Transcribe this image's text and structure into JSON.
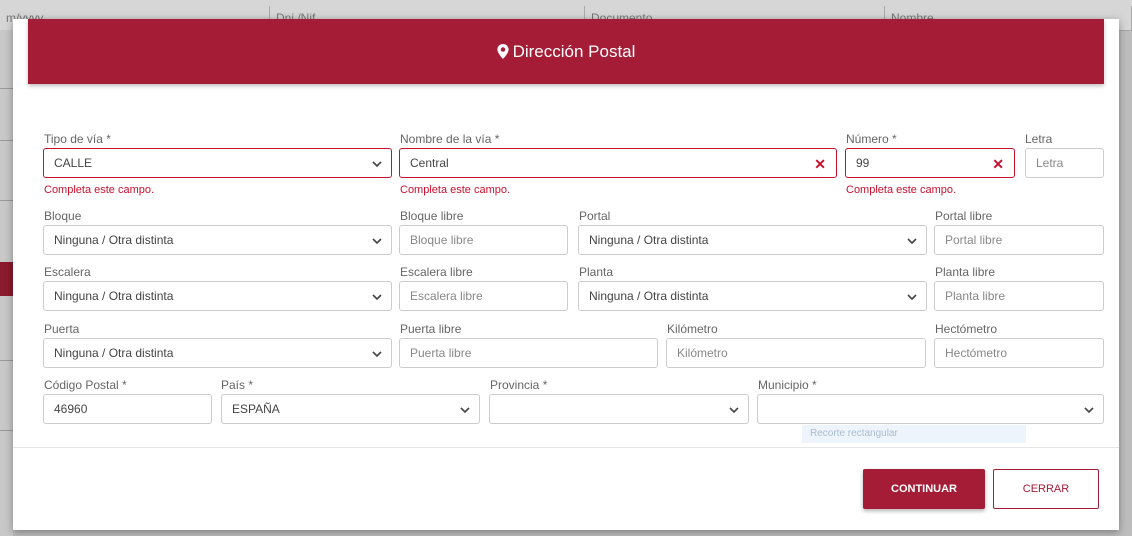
{
  "background": {
    "fields": [
      "m/yyyy",
      "Dni /Nif",
      "Documento",
      "Nombre"
    ]
  },
  "modal": {
    "title": "Dirección Postal",
    "title_icon": "map-marker-icon",
    "accent_color": "#a51c36",
    "error_color": "#c8102e",
    "rows": {
      "row1": {
        "tipo_via": {
          "label": "Tipo de vía *",
          "value": "CALLE",
          "error": "Completa este campo."
        },
        "nombre_via": {
          "label": "Nombre de la vía *",
          "value": "Central",
          "error": "Completa este campo."
        },
        "numero": {
          "label": "Número *",
          "value": "99",
          "error": "Completa este campo."
        },
        "letra": {
          "label": "Letra",
          "placeholder": "Letra"
        }
      },
      "row2": {
        "bloque": {
          "label": "Bloque",
          "value": "Ninguna / Otra distinta"
        },
        "bloque_libre": {
          "label": "Bloque libre",
          "placeholder": "Bloque libre"
        },
        "portal": {
          "label": "Portal",
          "value": "Ninguna / Otra distinta"
        },
        "portal_libre": {
          "label": "Portal libre",
          "placeholder": "Portal libre"
        }
      },
      "row3": {
        "escalera": {
          "label": "Escalera",
          "value": "Ninguna / Otra distinta"
        },
        "escalera_libre": {
          "label": "Escalera libre",
          "placeholder": "Escalera libre"
        },
        "planta": {
          "label": "Planta",
          "value": "Ninguna / Otra distinta"
        },
        "planta_libre": {
          "label": "Planta libre",
          "placeholder": "Planta libre"
        }
      },
      "row4": {
        "puerta": {
          "label": "Puerta",
          "value": "Ninguna / Otra distinta"
        },
        "puerta_libre": {
          "label": "Puerta libre",
          "placeholder": "Puerta libre"
        },
        "kilometro": {
          "label": "Kilómetro",
          "placeholder": "Kilómetro"
        },
        "hectometro": {
          "label": "Hectómetro",
          "placeholder": "Hectómetro"
        }
      },
      "row5": {
        "codigo_postal": {
          "label": "Código Postal *",
          "value": "46960"
        },
        "pais": {
          "label": "País *",
          "value": "ESPAÑA"
        },
        "provincia": {
          "label": "Provincia *",
          "value": ""
        },
        "municipio": {
          "label": "Municipio *",
          "value": ""
        }
      }
    },
    "autocomplete_hint": "Recorte rectangular",
    "buttons": {
      "continue": "CONTINUAR",
      "close": "CERRAR"
    }
  }
}
